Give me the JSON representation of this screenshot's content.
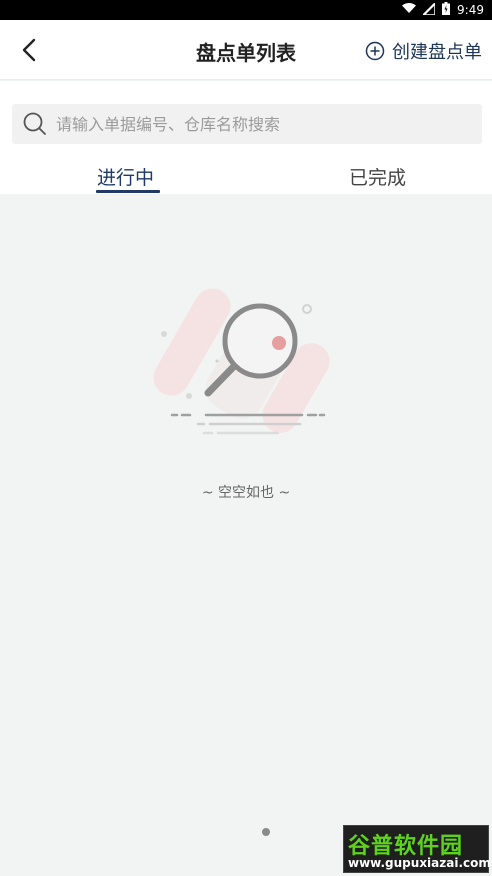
{
  "status_bar": {
    "time": "9:49",
    "icons": [
      "wifi-icon",
      "signal-icon",
      "battery-icon"
    ]
  },
  "nav": {
    "title": "盘点单列表",
    "create_label": "创建盘点单"
  },
  "search": {
    "placeholder": "请输入单据编号、仓库名称搜索",
    "value": ""
  },
  "tabs": [
    {
      "label": "进行中",
      "active": true
    },
    {
      "label": "已完成",
      "active": false
    }
  ],
  "empty_state": {
    "text": "~ 空空如也 ~"
  },
  "watermark": {
    "logo": "谷普软件园",
    "url": "www.gupuxiazai.com"
  },
  "colors": {
    "accent": "#1f3a66",
    "background": "#f2f3f3",
    "watermark_green": "#5fd21f"
  }
}
